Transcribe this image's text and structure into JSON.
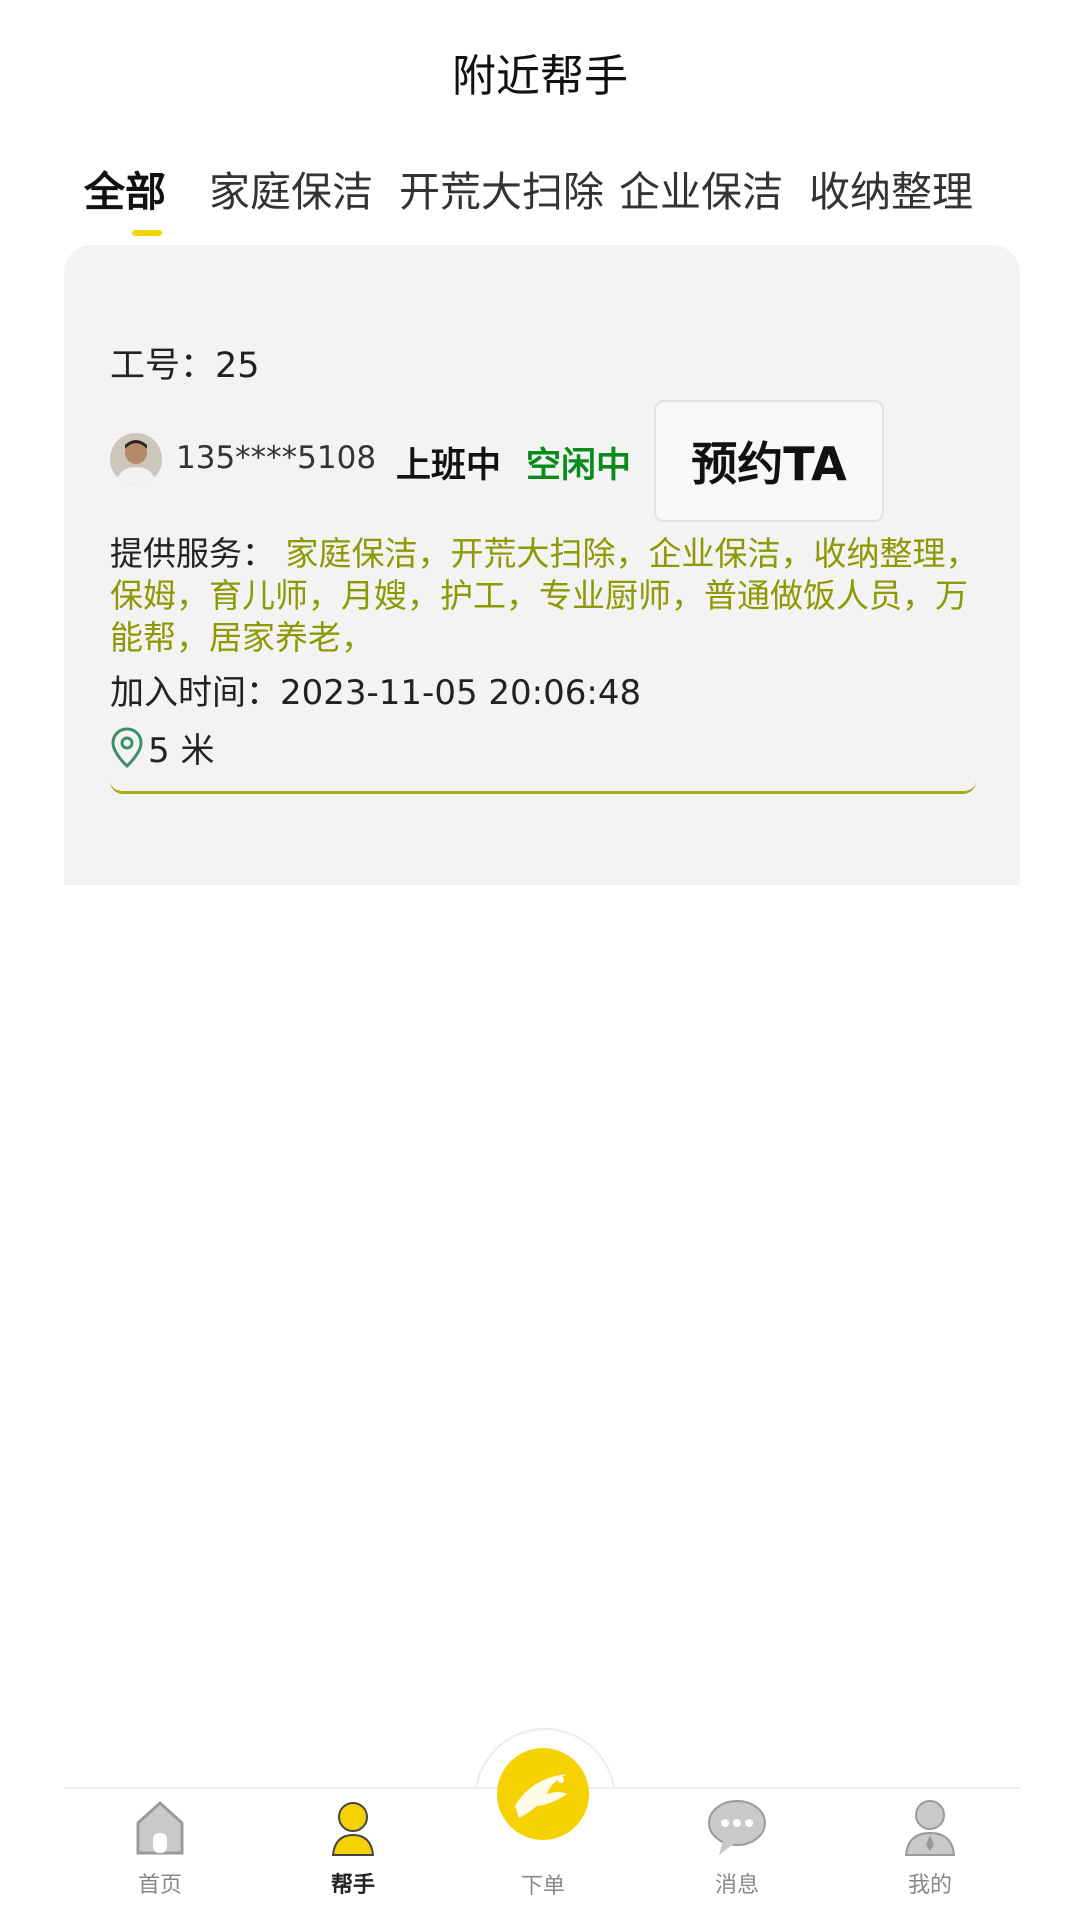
{
  "header": {
    "title": "附近帮手"
  },
  "tabs": [
    {
      "label": "全部"
    },
    {
      "label": "家庭保洁"
    },
    {
      "label": "开荒大扫除"
    },
    {
      "label": "企业保洁"
    },
    {
      "label": "收纳整理"
    }
  ],
  "card": {
    "job_no": "工号：25",
    "phone": "135****5108",
    "status_work": "上班中",
    "status_idle": "空闲中",
    "book_label": "预约TA",
    "services_label": "提供服务：",
    "services_value": "家庭保洁，开荒大扫除，企业保洁，收纳整理，保姆，育儿师，月嫂，护工，专业厨师，普通做饭人员，万能帮，居家养老，",
    "joined": "加入时间：2023-11-05 20:06:48",
    "distance": "5 米"
  },
  "nav": {
    "home": "首页",
    "helper": "帮手",
    "order": "下单",
    "message": "消息",
    "mine": "我的"
  },
  "colors": {
    "accent": "#f6d100",
    "idle": "#0a8a1a",
    "services": "#8a9a00"
  },
  "icons": [
    "home-icon",
    "helper-icon",
    "bird-logo-icon",
    "message-icon",
    "profile-icon",
    "location-pin-icon"
  ]
}
